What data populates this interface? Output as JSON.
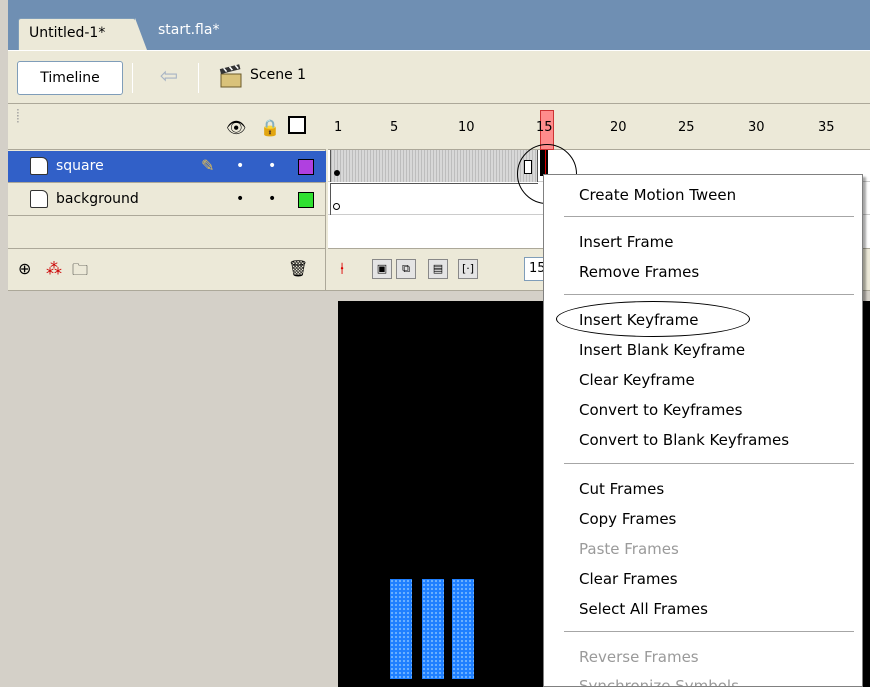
{
  "tabs": {
    "active": "Untitled-1*",
    "inactive": "start.fla*"
  },
  "editbar": {
    "timeline_label": "Timeline",
    "scene_label": "Scene 1",
    "back_icon": "back-arrow-icon",
    "scene_icon": "clapper-icon"
  },
  "timeline": {
    "header_icons": [
      "eye-icon",
      "lock-icon",
      "outline-icon"
    ],
    "layers": [
      {
        "name": "square",
        "selected": true,
        "color": "#b040e0"
      },
      {
        "name": "background",
        "selected": false,
        "color": "#30e030"
      }
    ],
    "ruler": [
      "1",
      "5",
      "10",
      "15",
      "20",
      "25",
      "30",
      "35"
    ],
    "current_frame": "15"
  },
  "context_menu": {
    "group1": [
      "Create Motion Tween"
    ],
    "group2": [
      "Insert Frame",
      "Remove Frames"
    ],
    "group3": [
      "Insert Keyframe",
      "Insert Blank Keyframe",
      "Clear Keyframe",
      "Convert to Keyframes",
      "Convert to Blank Keyframes"
    ],
    "group4": [
      "Cut Frames",
      "Copy Frames",
      "Paste Frames",
      "Clear Frames",
      "Select All Frames"
    ],
    "group5": [
      "Reverse Frames",
      "Synchronize Symbols"
    ]
  },
  "colors": {
    "selection": "#3160c8",
    "stage": "#000000",
    "bars": "#1f7fff",
    "playhead": "#ff8c8c"
  }
}
